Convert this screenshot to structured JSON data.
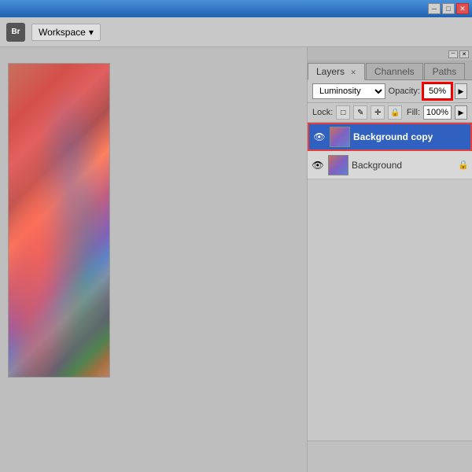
{
  "titlebar": {
    "minimize_label": "─",
    "maximize_label": "□",
    "close_label": "✕"
  },
  "toolbar": {
    "bridge_label": "Br",
    "workspace_label": "Workspace",
    "workspace_arrow": "▾"
  },
  "panel": {
    "title_close_label": "✕",
    "title_min_label": "─",
    "tabs": [
      {
        "id": "layers",
        "label": "Layers",
        "active": true,
        "closeable": true
      },
      {
        "id": "channels",
        "label": "Channels",
        "active": false,
        "closeable": false
      },
      {
        "id": "paths",
        "label": "Paths",
        "active": false,
        "closeable": false
      }
    ],
    "blend_mode": "Luminosity",
    "opacity_label": "Opacity:",
    "opacity_value": "50%",
    "lock_label": "Lock:",
    "lock_icons": [
      "□",
      "✎",
      "✛",
      "🔒"
    ],
    "fill_label": "Fill:",
    "fill_value": "100%",
    "layers": [
      {
        "id": "background-copy",
        "name": "Background copy",
        "visible": true,
        "active": true,
        "locked": false
      },
      {
        "id": "background",
        "name": "Background",
        "visible": true,
        "active": false,
        "locked": true
      }
    ]
  },
  "colors": {
    "active_layer_bg": "#3060c0",
    "active_layer_border": "#e04040",
    "opacity_border": "#cc0000",
    "title_bar_gradient_start": "#4a90d9",
    "title_bar_gradient_end": "#2060b0"
  }
}
